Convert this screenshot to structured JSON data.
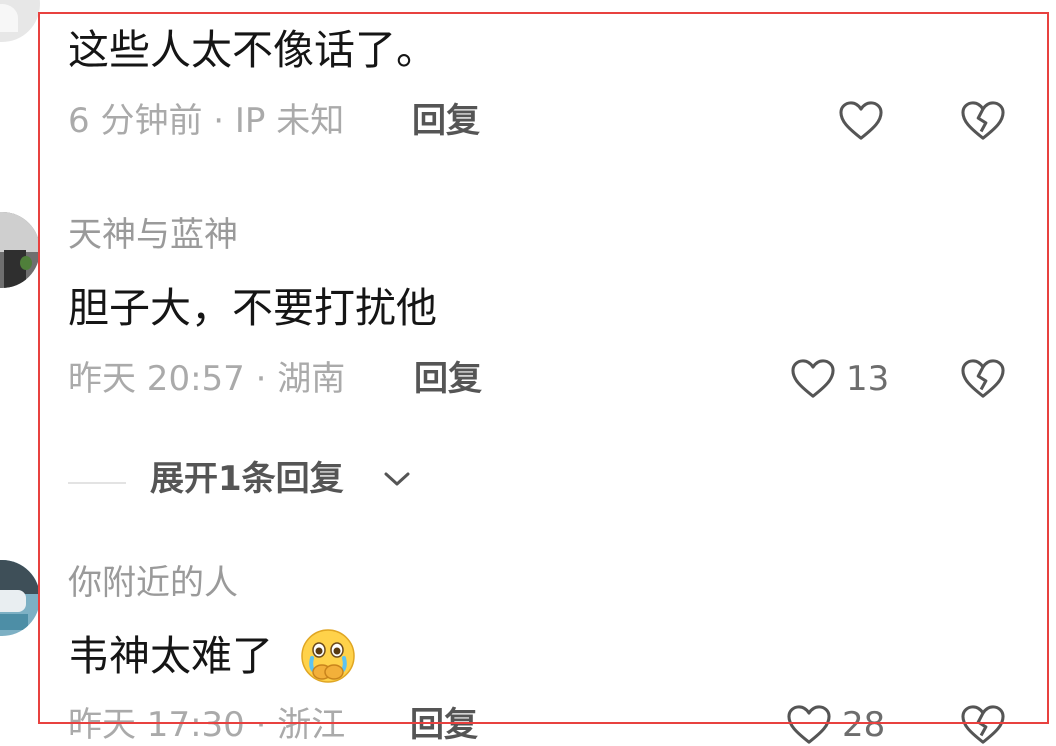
{
  "comments": [
    {
      "username": "",
      "text": "这些人太不像话了。",
      "meta": "6 分钟前 · IP 未知",
      "reply_label": "回复",
      "like_count": ""
    },
    {
      "username": "天神与蓝神",
      "text": "胆子大，不要打扰他",
      "meta": "昨天 20:57 · 湖南",
      "reply_label": "回复",
      "like_count": "13"
    },
    {
      "username": "你附近的人",
      "text": "韦神太难了",
      "meta": "昨天 17:30 · 浙江",
      "reply_label": "回复",
      "like_count": "28"
    }
  ],
  "expand_replies_label": "展开1条回复",
  "icons": {
    "like": "heart-outline-icon",
    "dislike": "broken-heart-icon",
    "expand": "chevron-down-icon",
    "emoji": "crying-face-emoji"
  },
  "colors": {
    "highlight_border": "#e8413f",
    "primary_text": "#151515",
    "secondary_text": "#aaaaaa"
  }
}
